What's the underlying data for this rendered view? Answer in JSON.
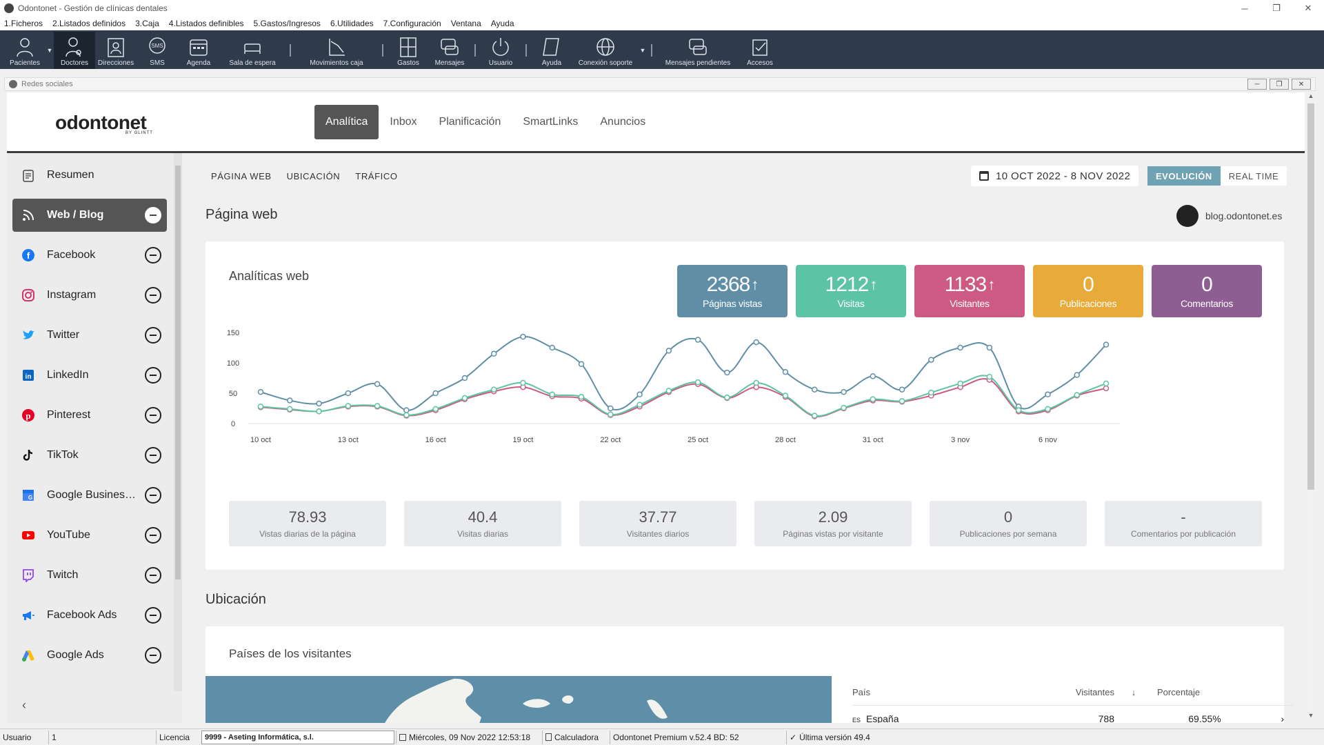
{
  "window": {
    "title": "Odontonet - Gestión de clínicas dentales",
    "minimize": "─",
    "maximize": "❐",
    "close": "✕"
  },
  "menu": [
    "1.Ficheros",
    "2.Listados definidos",
    "3.Caja",
    "4.Listados definibles",
    "5.Gastos/Ingresos",
    "6.Utilidades",
    "7.Configuración",
    "Ventana",
    "Ayuda"
  ],
  "toolbar": {
    "pacientes": "Pacientes",
    "doctores": "Doctores",
    "direcciones": "Direcciones",
    "sms": "SMS",
    "agenda": "Agenda",
    "sala_espera": "Sala de espera",
    "movimientos_caja": "Movimientos caja",
    "gastos": "Gastos",
    "mensajes": "Mensajes",
    "usuario": "Usuario",
    "ayuda": "Ayuda",
    "conexion_soporte": "Conexión soporte",
    "mensajes_pendientes": "Mensajes pendientes",
    "accesos": "Accesos",
    "sms_icon_text": "SMS"
  },
  "subwindow": {
    "title": "Redes sociales"
  },
  "brand": {
    "logo": "odontonet",
    "sub": "BY GLINTT"
  },
  "nav": {
    "analitica": "Analítica",
    "inbox": "Inbox",
    "planificacion": "Planificación",
    "smartlinks": "SmartLinks",
    "anuncios": "Anuncios"
  },
  "sidebar": {
    "items": [
      {
        "label": "Resumen",
        "icon": "clipboard-icon"
      },
      {
        "label": "Web / Blog",
        "icon": "rss-icon"
      },
      {
        "label": "Facebook",
        "icon": "facebook-icon"
      },
      {
        "label": "Instagram",
        "icon": "instagram-icon"
      },
      {
        "label": "Twitter",
        "icon": "twitter-icon"
      },
      {
        "label": "LinkedIn",
        "icon": "linkedin-icon"
      },
      {
        "label": "Pinterest",
        "icon": "pinterest-icon"
      },
      {
        "label": "TikTok",
        "icon": "tiktok-icon"
      },
      {
        "label": "Google Business Profile",
        "icon": "google-business-icon"
      },
      {
        "label": "YouTube",
        "icon": "youtube-icon"
      },
      {
        "label": "Twitch",
        "icon": "twitch-icon"
      },
      {
        "label": "Facebook Ads",
        "icon": "megaphone-icon"
      },
      {
        "label": "Google Ads",
        "icon": "google-ads-icon"
      }
    ],
    "collapse": "‹"
  },
  "subtabs": {
    "pagina_web": "PÁGINA WEB",
    "ubicacion": "UBICACIÓN",
    "trafico": "TRÁFICO"
  },
  "date_range": "10 OCT 2022 - 8 NOV 2022",
  "mode": {
    "evolucion": "EVOLUCIÓN",
    "realtime": "REAL TIME"
  },
  "section_web": "Página web",
  "blog": "blog.odontonet.es",
  "card_title": "Analíticas web",
  "kpis": [
    {
      "value": "2368",
      "arrow": "↑",
      "label": "Páginas vistas",
      "color": "#5f8ea6"
    },
    {
      "value": "1212",
      "arrow": "↑",
      "label": "Visitas",
      "color": "#5cc4a4"
    },
    {
      "value": "1133",
      "arrow": "↑",
      "label": "Visitantes",
      "color": "#cc5a82"
    },
    {
      "value": "0",
      "arrow": "",
      "label": "Publicaciones",
      "color": "#e8aa38"
    },
    {
      "value": "0",
      "arrow": "",
      "label": "Comentarios",
      "color": "#8e5e92"
    }
  ],
  "chart_data": {
    "type": "line",
    "x": [
      "10 oct",
      "11 oct",
      "12 oct",
      "13 oct",
      "14 oct",
      "15 oct",
      "16 oct",
      "17 oct",
      "18 oct",
      "19 oct",
      "20 oct",
      "21 oct",
      "22 oct",
      "23 oct",
      "24 oct",
      "25 oct",
      "26 oct",
      "27 oct",
      "28 oct",
      "29 oct",
      "30 oct",
      "31 oct",
      "1 nov",
      "2 nov",
      "3 nov",
      "4 nov",
      "5 nov",
      "6 nov",
      "7 nov",
      "8 nov"
    ],
    "xticks": [
      "10 oct",
      "13 oct",
      "16 oct",
      "19 oct",
      "22 oct",
      "25 oct",
      "28 oct",
      "31 oct",
      "3 nov",
      "6 nov"
    ],
    "yticks": [
      0,
      50,
      100,
      150
    ],
    "ylim": [
      0,
      150
    ],
    "series": [
      {
        "name": "Páginas vistas",
        "color": "#5f8ea6",
        "values": [
          52,
          38,
          33,
          50,
          65,
          22,
          50,
          75,
          115,
          143,
          125,
          98,
          25,
          48,
          120,
          138,
          84,
          134,
          85,
          56,
          52,
          78,
          56,
          105,
          125,
          125,
          28,
          48,
          80,
          130
        ]
      },
      {
        "name": "Visitantes",
        "color": "#cc5a82",
        "values": [
          27,
          23,
          20,
          28,
          28,
          13,
          22,
          40,
          53,
          60,
          45,
          41,
          14,
          28,
          52,
          65,
          42,
          60,
          44,
          12,
          25,
          38,
          36,
          46,
          60,
          72,
          20,
          22,
          46,
          58
        ]
      },
      {
        "name": "Visitas",
        "color": "#5cc4a4",
        "values": [
          28,
          24,
          20,
          29,
          29,
          14,
          24,
          42,
          56,
          67,
          48,
          44,
          15,
          31,
          54,
          68,
          43,
          67,
          46,
          13,
          26,
          40,
          37,
          51,
          66,
          77,
          22,
          24,
          47,
          66
        ]
      }
    ]
  },
  "stats": [
    {
      "value": "78.93",
      "label": "Vistas diarias de la página"
    },
    {
      "value": "40.4",
      "label": "Visitas diarias"
    },
    {
      "value": "37.77",
      "label": "Visitantes diarios"
    },
    {
      "value": "2.09",
      "label": "Páginas vistas por visitante"
    },
    {
      "value": "0",
      "label": "Publicaciones por semana"
    },
    {
      "value": "-",
      "label": "Comentarios por publicación"
    }
  ],
  "section_ubicacion": "Ubicación",
  "countries_card": {
    "title": "Países de los visitantes",
    "headers": {
      "pais": "País",
      "visitantes": "Visitantes",
      "sort": "↓",
      "porcentaje": "Porcentaje"
    },
    "rows": [
      {
        "code": "ES",
        "name": "España",
        "visitors": "788",
        "pct": "69.55%",
        "arrow": "›"
      }
    ]
  },
  "status": {
    "usuario_lbl": "Usuario",
    "usuario_val": "1",
    "licencia_lbl": "Licencia",
    "licencia_val": "9999 - Aseting Informática, s.l.",
    "fecha": "Miércoles, 09 Nov 2022 12:53:18",
    "calculadora": "Calculadora",
    "version": "Odontonet Premium v.52.4 BD: 52",
    "ultima": "Última versión 49.4"
  }
}
